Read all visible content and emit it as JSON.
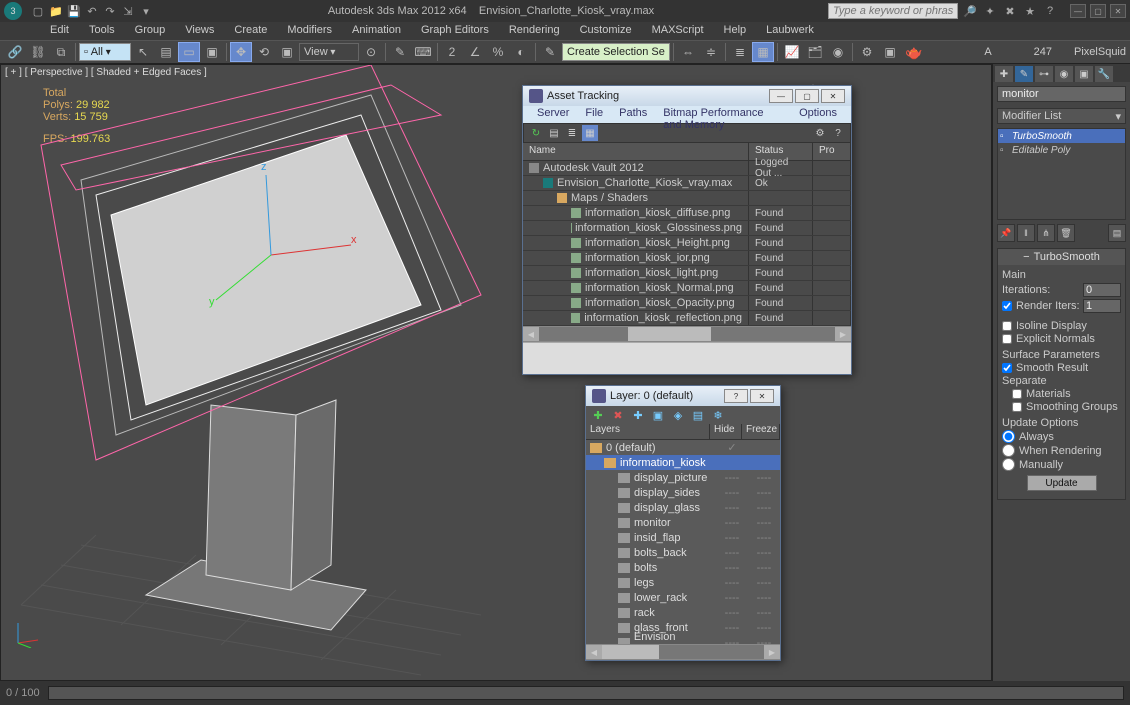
{
  "titlebar": {
    "app": "Autodesk 3ds Max  2012 x64",
    "file": "Envision_Charlotte_Kiosk_vray.max",
    "search_placeholder": "Type a keyword or phrase"
  },
  "menus": [
    "Edit",
    "Tools",
    "Group",
    "Views",
    "Create",
    "Modifiers",
    "Animation",
    "Graph Editors",
    "Rendering",
    "Customize",
    "MAXScript",
    "Help",
    "Laubwerk"
  ],
  "toolbar": {
    "sel_filter": "All",
    "view_mode": "View",
    "create_set": "Create Selection Se",
    "right_label_a": "A",
    "right_label_num": "247",
    "right_label_ps": "PixelSquid"
  },
  "viewport": {
    "label": "[ + ] [ Perspective ] [ Shaded + Edged Faces ]",
    "stats_label_total": "Total",
    "polys_label": "Polys:",
    "polys": "29 982",
    "verts_label": "Verts:",
    "verts": "15 759",
    "fps_label": "FPS:",
    "fps": "199.763"
  },
  "sidebar": {
    "object_name": "monitor",
    "modlist_label": "Modifier List",
    "stack": [
      {
        "name": "TurboSmooth",
        "sel": true
      },
      {
        "name": "Editable Poly",
        "sel": false
      }
    ],
    "panel_title": "TurboSmooth",
    "main_label": "Main",
    "iterations_label": "Iterations:",
    "iterations": "0",
    "render_iters_chk": "Render Iters:",
    "render_iters": "1",
    "isoline": "Isoline Display",
    "explicit": "Explicit Normals",
    "surfparams": "Surface Parameters",
    "smoothresult": "Smooth Result",
    "separate": "Separate",
    "materials": "Materials",
    "smgroups": "Smoothing Groups",
    "updopts": "Update Options",
    "opt_always": "Always",
    "opt_render": "When Rendering",
    "opt_manual": "Manually",
    "update": "Update"
  },
  "asset_tracking": {
    "title": "Asset Tracking",
    "menus": [
      "Server",
      "File",
      "Paths",
      "Bitmap Performance and Memory",
      "Options"
    ],
    "head": [
      "Name",
      "Status",
      "Pro"
    ],
    "rows": [
      {
        "indent": 0,
        "name": "Autodesk Vault 2012",
        "status": "Logged Out ...",
        "icon": "vault"
      },
      {
        "indent": 1,
        "name": "Envision_Charlotte_Kiosk_vray.max",
        "status": "Ok",
        "icon": "max"
      },
      {
        "indent": 2,
        "name": "Maps / Shaders",
        "status": "",
        "icon": "folder"
      },
      {
        "indent": 3,
        "name": "information_kiosk_diffuse.png",
        "status": "Found",
        "icon": "map"
      },
      {
        "indent": 3,
        "name": "information_kiosk_Glossiness.png",
        "status": "Found",
        "icon": "map"
      },
      {
        "indent": 3,
        "name": "information_kiosk_Height.png",
        "status": "Found",
        "icon": "map"
      },
      {
        "indent": 3,
        "name": "information_kiosk_ior.png",
        "status": "Found",
        "icon": "map"
      },
      {
        "indent": 3,
        "name": "information_kiosk_light.png",
        "status": "Found",
        "icon": "map"
      },
      {
        "indent": 3,
        "name": "information_kiosk_Normal.png",
        "status": "Found",
        "icon": "map"
      },
      {
        "indent": 3,
        "name": "information_kiosk_Opacity.png",
        "status": "Found",
        "icon": "map"
      },
      {
        "indent": 3,
        "name": "information_kiosk_reflection.png",
        "status": "Found",
        "icon": "map"
      }
    ]
  },
  "layer_win": {
    "title": "Layer: 0 (default)",
    "head": [
      "Layers",
      "Hide",
      "Freeze"
    ],
    "rows": [
      {
        "indent": 0,
        "name": "0 (default)",
        "sel": false,
        "icon": "fold",
        "hide": "✓",
        "freeze": ""
      },
      {
        "indent": 1,
        "name": "information_kiosk",
        "sel": true,
        "icon": "fold",
        "hide": "",
        "freeze": ""
      },
      {
        "indent": 2,
        "name": "display_picture",
        "sel": false,
        "icon": "obj",
        "hide": "----",
        "freeze": "----"
      },
      {
        "indent": 2,
        "name": "display_sides",
        "sel": false,
        "icon": "obj",
        "hide": "----",
        "freeze": "----"
      },
      {
        "indent": 2,
        "name": "display_glass",
        "sel": false,
        "icon": "obj",
        "hide": "----",
        "freeze": "----"
      },
      {
        "indent": 2,
        "name": "monitor",
        "sel": false,
        "icon": "obj",
        "hide": "----",
        "freeze": "----"
      },
      {
        "indent": 2,
        "name": "insid_flap",
        "sel": false,
        "icon": "obj",
        "hide": "----",
        "freeze": "----"
      },
      {
        "indent": 2,
        "name": "bolts_back",
        "sel": false,
        "icon": "obj",
        "hide": "----",
        "freeze": "----"
      },
      {
        "indent": 2,
        "name": "bolts",
        "sel": false,
        "icon": "obj",
        "hide": "----",
        "freeze": "----"
      },
      {
        "indent": 2,
        "name": "legs",
        "sel": false,
        "icon": "obj",
        "hide": "----",
        "freeze": "----"
      },
      {
        "indent": 2,
        "name": "lower_rack",
        "sel": false,
        "icon": "obj",
        "hide": "----",
        "freeze": "----"
      },
      {
        "indent": 2,
        "name": "rack",
        "sel": false,
        "icon": "obj",
        "hide": "----",
        "freeze": "----"
      },
      {
        "indent": 2,
        "name": "glass_front",
        "sel": false,
        "icon": "obj",
        "hide": "----",
        "freeze": "----"
      },
      {
        "indent": 2,
        "name": "Envision Charlott",
        "sel": false,
        "icon": "obj",
        "hide": "----",
        "freeze": "----"
      }
    ]
  },
  "statusbar": {
    "frame": "0 / 100"
  },
  "colors": {
    "sel": "#4a6fbb"
  }
}
